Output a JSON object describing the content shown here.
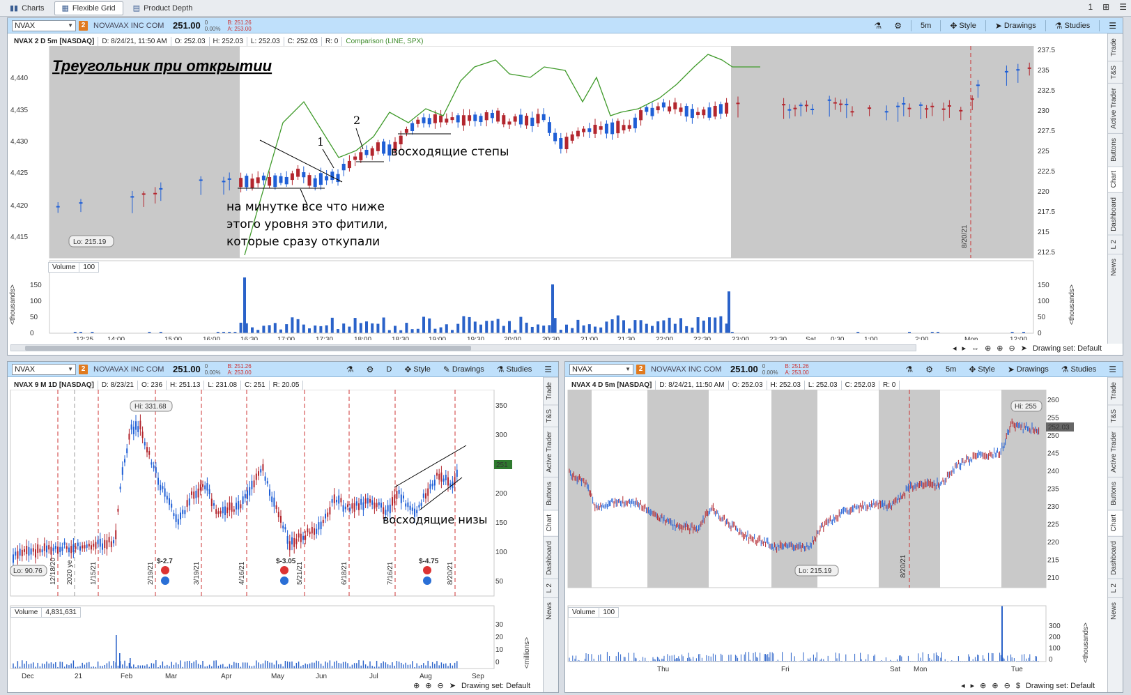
{
  "tabs": [
    {
      "label": "Charts",
      "icon": "bar-chart-icon",
      "active": false
    },
    {
      "label": "Flexible Grid",
      "icon": "grid-icon",
      "active": true
    },
    {
      "label": "Product Depth",
      "icon": "depth-icon",
      "active": false
    }
  ],
  "tabbar_right": {
    "page": "1"
  },
  "panel_main": {
    "symbol": "NVAX",
    "link": "2",
    "company": "NOVAVAX INC COM",
    "last": "251.00",
    "chg_top": "0",
    "chg_pct": "0.00%",
    "bid": "B: 251.26",
    "ask": "A: 253.00",
    "aggregation": "5m",
    "btn_style": "Style",
    "btn_drawings": "Drawings",
    "btn_studies": "Studies",
    "info": {
      "title": "NVAX 2 D 5m [NASDAQ]",
      "date": "D: 8/24/21, 11:50 AM",
      "open": "O: 252.03",
      "high": "H: 252.03",
      "low": "L: 252.03",
      "close": "C: 252.03",
      "r": "R: 0",
      "comparison": "Comparison (LINE, SPX)"
    },
    "heading": "Треугольник при открытии",
    "ann_1": "1",
    "ann_2": "2",
    "ann_steps": "восходящие степы",
    "ann_wicks_1": "на минутке все что ниже",
    "ann_wicks_2": "этого уровня это фитили,",
    "ann_wicks_3": "которые сразу откупали",
    "lo_label": "Lo: 215.19",
    "date_marker": "8/20/21",
    "left_axis": [
      "4,440",
      "4,435",
      "4,430",
      "4,425",
      "4,420",
      "4,415"
    ],
    "right_axis": [
      "237.5",
      "235",
      "232.5",
      "230",
      "227.5",
      "225",
      "222.5",
      "220",
      "217.5",
      "215",
      "212.5"
    ],
    "volume_label": "Volume",
    "volume_value": "100",
    "vol_axis": [
      "150",
      "100",
      "50",
      "0"
    ],
    "vol_unit": "<thousands>",
    "time_axis": [
      "12:25",
      "14:00",
      "15:00",
      "16:00",
      "16:30",
      "17:00",
      "17:30",
      "18:00",
      "18:30",
      "19:00",
      "19:30",
      "20:00",
      "20:30",
      "21:00",
      "21:30",
      "22:00",
      "22:30",
      "23:00",
      "23:30",
      "Sat",
      "0:30",
      "1:00",
      "2:00",
      "Mon",
      "12:00"
    ],
    "drawing_set": "Drawing set: Default",
    "side_tabs": [
      "Trade",
      "T&S",
      "Active Trader",
      "Buttons",
      "Chart",
      "Dashboard",
      "L 2",
      "News"
    ]
  },
  "panel_daily": {
    "symbol": "NVAX",
    "link": "2",
    "company": "NOVAVAX INC COM",
    "last": "251.00",
    "chg_top": "0",
    "chg_pct": "0.00%",
    "bid": "B: 251.26",
    "ask": "A: 253.00",
    "aggregation": "D",
    "btn_style": "Style",
    "btn_drawings": "Drawings",
    "btn_studies": "Studies",
    "info": {
      "title": "NVAX 9 M 1D [NASDAQ]",
      "date": "D: 8/23/21",
      "open": "O: 236",
      "high": "H: 251.13",
      "low": "L: 231.08",
      "close": "C: 251",
      "r": "R: 20.05"
    },
    "hi_label": "Hi: 331.68",
    "lo_label": "Lo: 90.76",
    "price_tag": "251",
    "ann_lows": "восходящие низы",
    "year_marker": "2020 ye",
    "date_markers": [
      "12/18/20",
      "1/15/21",
      "2/19/21",
      "3/19/21",
      "4/16/21",
      "5/21/21",
      "6/18/21",
      "7/16/21",
      "8/20/21"
    ],
    "earnings": [
      "$-2.7",
      "$-3.05",
      "$-4.75"
    ],
    "right_axis": [
      "350",
      "300",
      "250",
      "200",
      "150",
      "100",
      "50"
    ],
    "volume_label": "Volume",
    "volume_value": "4,831,631",
    "vol_axis": [
      "30",
      "20",
      "10",
      "0"
    ],
    "vol_unit": "<millions>",
    "time_axis": [
      "Dec",
      "21",
      "Feb",
      "Mar",
      "Apr",
      "May",
      "Jun",
      "Jul",
      "Aug",
      "Sep"
    ],
    "drawing_set": "Drawing set: Default",
    "side_tabs": [
      "Trade",
      "T&S",
      "Active Trader",
      "Buttons",
      "Chart",
      "Dashboard",
      "L 2",
      "News"
    ]
  },
  "panel_intraday": {
    "symbol": "NVAX",
    "link": "2",
    "company": "NOVAVAX INC COM",
    "last": "251.00",
    "chg_top": "0",
    "chg_pct": "0.00%",
    "bid": "B: 251.26",
    "ask": "A: 253.00",
    "aggregation": "5m",
    "btn_style": "Style",
    "btn_drawings": "Drawings",
    "btn_studies": "Studies",
    "info": {
      "title": "NVAX 4 D 5m [NASDAQ]",
      "date": "D: 8/24/21, 11:50 AM",
      "open": "O: 252.03",
      "high": "H: 252.03",
      "low": "L: 252.03",
      "close": "C: 252.03",
      "r": "R: 0"
    },
    "hi_label": "Hi: 255",
    "lo_label": "Lo: 215.19",
    "price_tag": "252.03",
    "date_marker": "8/20/21",
    "right_axis": [
      "260",
      "255",
      "250",
      "245",
      "240",
      "235",
      "230",
      "225",
      "220",
      "215",
      "210"
    ],
    "volume_label": "Volume",
    "volume_value": "100",
    "vol_axis": [
      "300",
      "200",
      "100",
      "0"
    ],
    "vol_unit": "<thousands>",
    "time_axis": [
      "Thu",
      "Fri",
      "Sat",
      "Mon",
      "Tue"
    ],
    "drawing_set": "Drawing set: Default",
    "side_tabs": [
      "Trade",
      "T&S",
      "Active Trader",
      "Buttons",
      "Chart",
      "Dashboard",
      "L 2",
      "News"
    ]
  },
  "colors": {
    "up": "#1f5fd6",
    "down": "#b3262e",
    "comparison": "#3f9a2a",
    "volume": "#2a62c9",
    "session_shade": "#c9c9c9",
    "toolbar": "#bfe0fb"
  }
}
